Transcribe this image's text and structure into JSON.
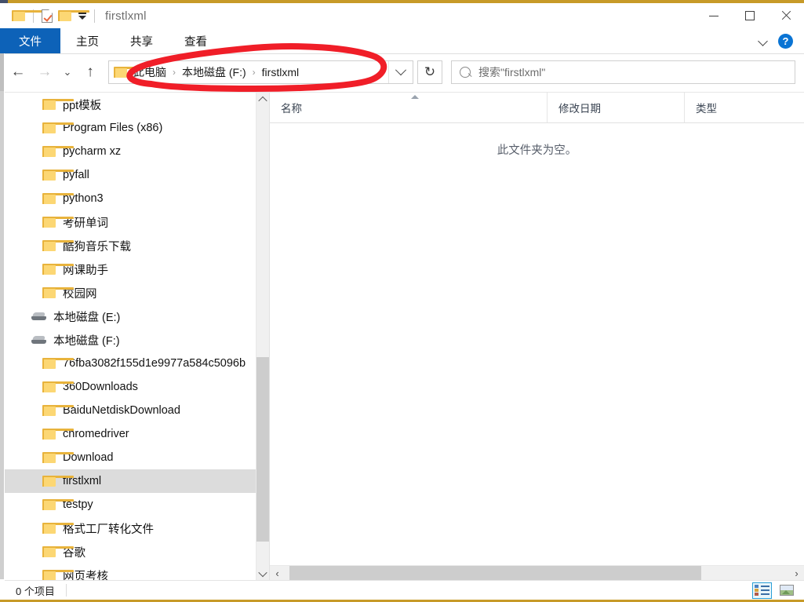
{
  "window": {
    "title": "firstlxml",
    "quick_access": [
      {
        "name": "folder-icon",
        "label": ""
      },
      {
        "name": "properties-icon",
        "label": ""
      },
      {
        "name": "new-folder-icon",
        "label": ""
      },
      {
        "name": "customize-qat-dropdown",
        "label": ""
      }
    ],
    "controls": {
      "minimize": "最小化",
      "maximize": "最大化",
      "close": "关闭"
    }
  },
  "ribbon": {
    "tabs": [
      {
        "label": "文件",
        "active": true
      },
      {
        "label": "主页",
        "active": false
      },
      {
        "label": "共享",
        "active": false
      },
      {
        "label": "查看",
        "active": false
      }
    ],
    "expand_icon": "chevron-down-icon",
    "help_label": "?"
  },
  "nav": {
    "back": "←",
    "forward": "→",
    "history": "⌄",
    "up": "↑",
    "refresh": "↻",
    "address": {
      "icon": "folder-icon",
      "crumbs": [
        "此电脑",
        "本地磁盘 (F:)",
        "firstlxml"
      ],
      "separator": "›",
      "dropdown_icon": "chevron-down-icon"
    },
    "search": {
      "icon": "search-icon",
      "placeholder": "搜索\"firstlxml\"",
      "value": ""
    }
  },
  "tree": {
    "items": [
      {
        "label": "ppt模板",
        "type": "folder"
      },
      {
        "label": "Program Files (x86)",
        "type": "folder"
      },
      {
        "label": "pycharm xz",
        "type": "folder"
      },
      {
        "label": "pyfall",
        "type": "folder"
      },
      {
        "label": "python3",
        "type": "folder"
      },
      {
        "label": "考研单词",
        "type": "folder"
      },
      {
        "label": "酷狗音乐下载",
        "type": "folder"
      },
      {
        "label": "网课助手",
        "type": "folder"
      },
      {
        "label": "校园网",
        "type": "folder"
      },
      {
        "label": "本地磁盘 (E:)",
        "type": "drive"
      },
      {
        "label": "本地磁盘 (F:)",
        "type": "drive"
      },
      {
        "label": "76fba3082f155d1e9977a584c5096b",
        "type": "folder"
      },
      {
        "label": "360Downloads",
        "type": "folder"
      },
      {
        "label": "BaiduNetdiskDownload",
        "type": "folder"
      },
      {
        "label": "chromedriver",
        "type": "folder"
      },
      {
        "label": "Download",
        "type": "folder"
      },
      {
        "label": "firstlxml",
        "type": "folder",
        "selected": true
      },
      {
        "label": "testpy",
        "type": "folder"
      },
      {
        "label": "格式工厂转化文件",
        "type": "folder"
      },
      {
        "label": "谷歌",
        "type": "folder"
      },
      {
        "label": "网页考核",
        "type": "folder"
      }
    ]
  },
  "file_list": {
    "columns": [
      {
        "label": "名称",
        "sorted": "asc"
      },
      {
        "label": "修改日期",
        "sorted": ""
      },
      {
        "label": "类型",
        "sorted": ""
      }
    ],
    "rows": [],
    "empty_message": "此文件夹为空。"
  },
  "status": {
    "item_count": "0 个项目",
    "views": [
      {
        "name": "details-view-button",
        "active": true
      },
      {
        "name": "large-icons-view-button",
        "active": false
      }
    ]
  },
  "annotation": {
    "shape": "hand-drawn-ellipse",
    "color": "#f01e28",
    "target": "address-bar"
  }
}
